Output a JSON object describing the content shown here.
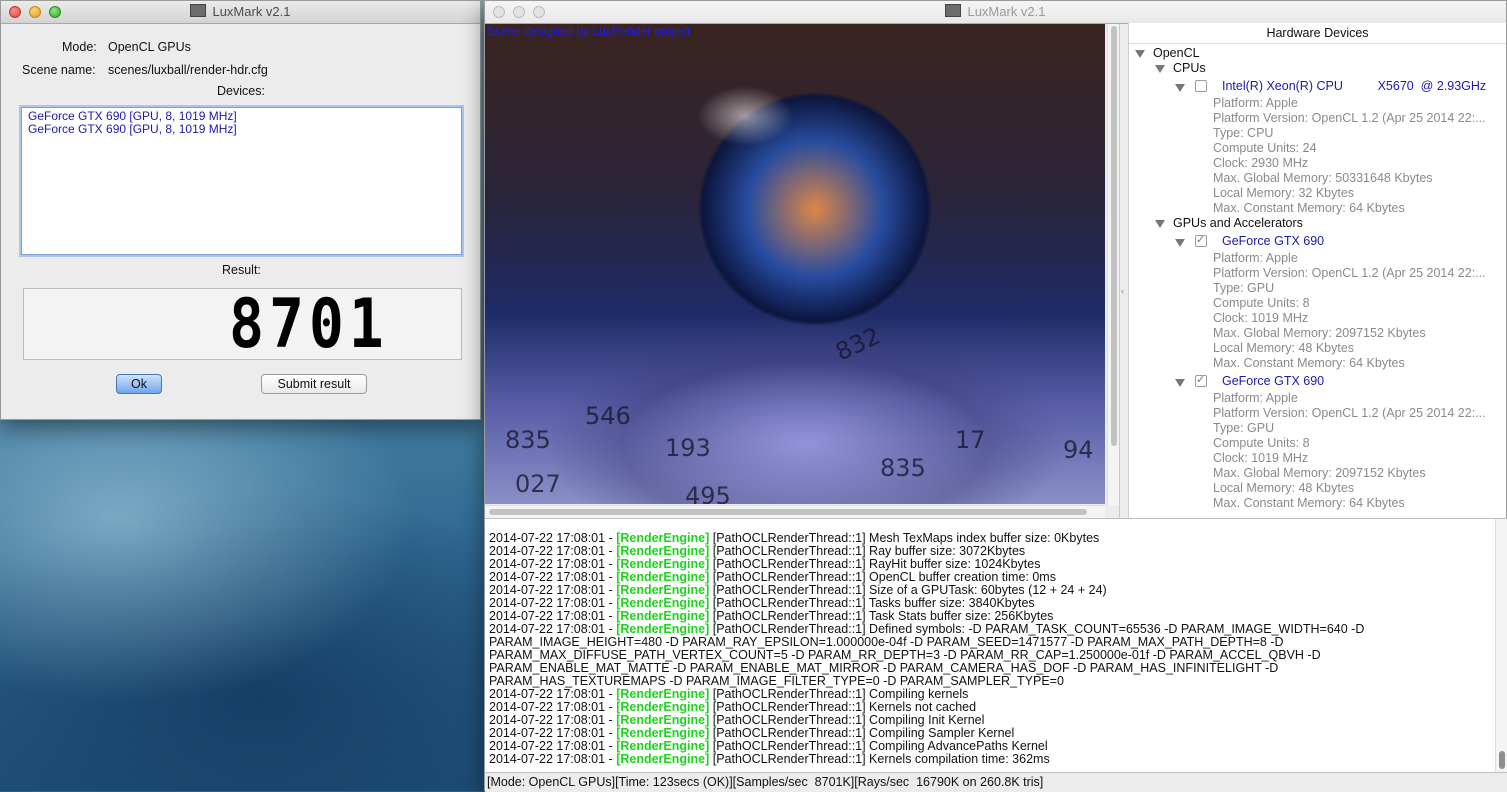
{
  "dialog": {
    "title": "LuxMark v2.1",
    "mode_label": "Mode:",
    "mode_value": "OpenCL GPUs",
    "scene_label": "Scene name:",
    "scene_value": "scenes/luxball/render-hdr.cfg",
    "devices_label": "Devices:",
    "devices": [
      "GeForce GTX 690 [GPU, 8, 1019 MHz]",
      "GeForce GTX 690 [GPU, 8, 1019 MHz]"
    ],
    "result_label": "Result:",
    "result_value": "8701",
    "ok_label": "Ok",
    "submit_label": "Submit result"
  },
  "main": {
    "title": "LuxMark v2.1",
    "render_caption": "Scene designed by LuxRender project",
    "render_numbers": [
      "832",
      "835",
      "193",
      "546",
      "835",
      "17",
      "027",
      "495",
      "94"
    ],
    "hardware": {
      "header": "Hardware Devices",
      "root": "OpenCL",
      "cpus_label": "CPUs",
      "cpu": {
        "name": "Intel(R) Xeon(R) CPU          X5670  @ 2.93GHz",
        "checked": false,
        "props": [
          "Platform: Apple",
          "Platform Version: OpenCL 1.2 (Apr 25 2014 22:...",
          "Type: CPU",
          "Compute Units: 24",
          "Clock: 2930 MHz",
          "Max. Global Memory: 50331648 Kbytes",
          "Local Memory: 32 Kbytes",
          "Max. Constant Memory: 64 Kbytes"
        ]
      },
      "gpus_label": "GPUs and Accelerators",
      "gpus": [
        {
          "name": "GeForce GTX 690",
          "checked": true,
          "props": [
            "Platform: Apple",
            "Platform Version: OpenCL 1.2 (Apr 25 2014 22:...",
            "Type: GPU",
            "Compute Units: 8",
            "Clock: 1019 MHz",
            "Max. Global Memory: 2097152 Kbytes",
            "Local Memory: 48 Kbytes",
            "Max. Constant Memory: 64 Kbytes"
          ]
        },
        {
          "name": "GeForce GTX 690",
          "checked": true,
          "props": [
            "Platform: Apple",
            "Platform Version: OpenCL 1.2 (Apr 25 2014 22:...",
            "Type: GPU",
            "Compute Units: 8",
            "Clock: 1019 MHz",
            "Max. Global Memory: 2097152 Kbytes",
            "Local Memory: 48 Kbytes",
            "Max. Constant Memory: 64 Kbytes"
          ]
        }
      ]
    },
    "log": [
      {
        "prefix": "2014-07-22 17:08:01 - ",
        "tag": "[RenderEngine]",
        "text": " [PathOCLRenderThread::1] Mesh TexMaps index buffer size: 0Kbytes"
      },
      {
        "prefix": "2014-07-22 17:08:01 - ",
        "tag": "[RenderEngine]",
        "text": " [PathOCLRenderThread::1] Ray buffer size: 3072Kbytes"
      },
      {
        "prefix": "2014-07-22 17:08:01 - ",
        "tag": "[RenderEngine]",
        "text": " [PathOCLRenderThread::1] RayHit buffer size: 1024Kbytes"
      },
      {
        "prefix": "2014-07-22 17:08:01 - ",
        "tag": "[RenderEngine]",
        "text": " [PathOCLRenderThread::1] OpenCL buffer creation time: 0ms"
      },
      {
        "prefix": "2014-07-22 17:08:01 - ",
        "tag": "[RenderEngine]",
        "text": " [PathOCLRenderThread::1] Size of a GPUTask: 60bytes (12 + 24 + 24)"
      },
      {
        "prefix": "2014-07-22 17:08:01 - ",
        "tag": "[RenderEngine]",
        "text": " [PathOCLRenderThread::1] Tasks buffer size: 3840Kbytes"
      },
      {
        "prefix": "2014-07-22 17:08:01 - ",
        "tag": "[RenderEngine]",
        "text": " [PathOCLRenderThread::1] Task Stats buffer size: 256Kbytes"
      },
      {
        "prefix": "2014-07-22 17:08:01 - ",
        "tag": "[RenderEngine]",
        "text": " [PathOCLRenderThread::1] Defined symbols: -D PARAM_TASK_COUNT=65536 -D PARAM_IMAGE_WIDTH=640 -D"
      },
      {
        "prefix": "",
        "tag": "",
        "text": "PARAM_IMAGE_HEIGHT=480 -D PARAM_RAY_EPSILON=1.000000e-04f -D PARAM_SEED=1471577 -D PARAM_MAX_PATH_DEPTH=8 -D"
      },
      {
        "prefix": "",
        "tag": "",
        "text": "PARAM_MAX_DIFFUSE_PATH_VERTEX_COUNT=5 -D PARAM_RR_DEPTH=3 -D PARAM_RR_CAP=1.250000e-01f -D PARAM_ACCEL_QBVH -D"
      },
      {
        "prefix": "",
        "tag": "",
        "text": "PARAM_ENABLE_MAT_MATTE -D PARAM_ENABLE_MAT_MIRROR -D PARAM_CAMERA_HAS_DOF -D PARAM_HAS_INFINITELIGHT -D"
      },
      {
        "prefix": "",
        "tag": "",
        "text": "PARAM_HAS_TEXTUREMAPS -D PARAM_IMAGE_FILTER_TYPE=0 -D PARAM_SAMPLER_TYPE=0"
      },
      {
        "prefix": "2014-07-22 17:08:01 - ",
        "tag": "[RenderEngine]",
        "text": " [PathOCLRenderThread::1] Compiling kernels"
      },
      {
        "prefix": "2014-07-22 17:08:01 - ",
        "tag": "[RenderEngine]",
        "text": " [PathOCLRenderThread::1] Kernels not cached"
      },
      {
        "prefix": "2014-07-22 17:08:01 - ",
        "tag": "[RenderEngine]",
        "text": " [PathOCLRenderThread::1] Compiling Init Kernel"
      },
      {
        "prefix": "2014-07-22 17:08:01 - ",
        "tag": "[RenderEngine]",
        "text": " [PathOCLRenderThread::1] Compiling Sampler Kernel"
      },
      {
        "prefix": "2014-07-22 17:08:01 - ",
        "tag": "[RenderEngine]",
        "text": " [PathOCLRenderThread::1] Compiling AdvancePaths Kernel"
      },
      {
        "prefix": "2014-07-22 17:08:01 - ",
        "tag": "[RenderEngine]",
        "text": " [PathOCLRenderThread::1] Kernels compilation time: 362ms"
      }
    ],
    "status": "[Mode: OpenCL GPUs][Time: 123secs (OK)][Samples/sec  8701K][Rays/sec  16790K on 260.8K tris]"
  },
  "colors": {
    "device_blue": "#1a1ab0",
    "engine_green": "#1fd31f",
    "caption_blue": "#1c1cff"
  }
}
